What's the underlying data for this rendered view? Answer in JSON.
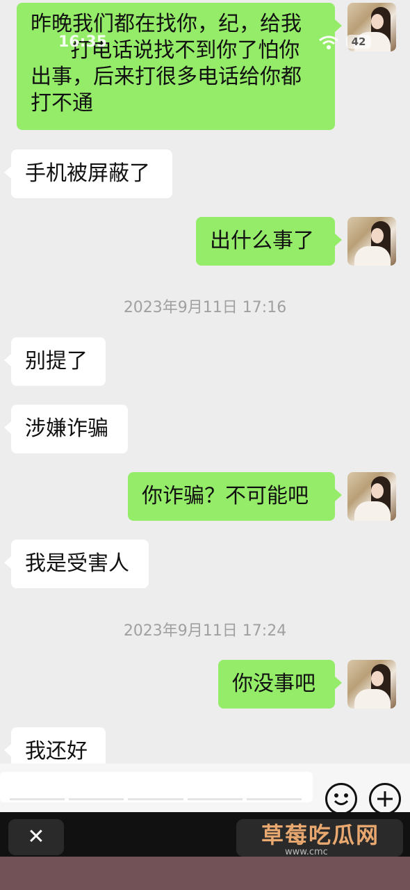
{
  "status_bar": {
    "clock": "16:35",
    "battery": "42"
  },
  "messages": [
    {
      "side": "right",
      "text": "昨晚我们都在找你，纪，给我\n      打电话说找不到你了怕你\n出事，后来打很多电话给你都\n打不通"
    },
    {
      "side": "left",
      "text": "手机被屏蔽了"
    },
    {
      "side": "right",
      "text": "出什么事了"
    },
    {
      "side": "time",
      "text": "2023年9月11日 17:16"
    },
    {
      "side": "left",
      "text": "别提了"
    },
    {
      "side": "left",
      "text": "涉嫌诈骗"
    },
    {
      "side": "right",
      "text": "你诈骗？不可能吧"
    },
    {
      "side": "left",
      "text": "我是受害人"
    },
    {
      "side": "time",
      "text": "2023年9月11日 17:24"
    },
    {
      "side": "right",
      "text": "你没事吧"
    },
    {
      "side": "left",
      "text": "我还好"
    }
  ],
  "input_bar": {
    "emoji_icon": "emoji-icon",
    "plus_icon": "plus-icon"
  },
  "overlay": {
    "close_label": "✕",
    "brand": "草莓吃瓜网",
    "brand_url": "www.cmc"
  },
  "colors": {
    "bubble_right": "#95ec69",
    "bubble_left": "#ffffff",
    "background": "#ededed",
    "bottom_band": "#735257"
  }
}
